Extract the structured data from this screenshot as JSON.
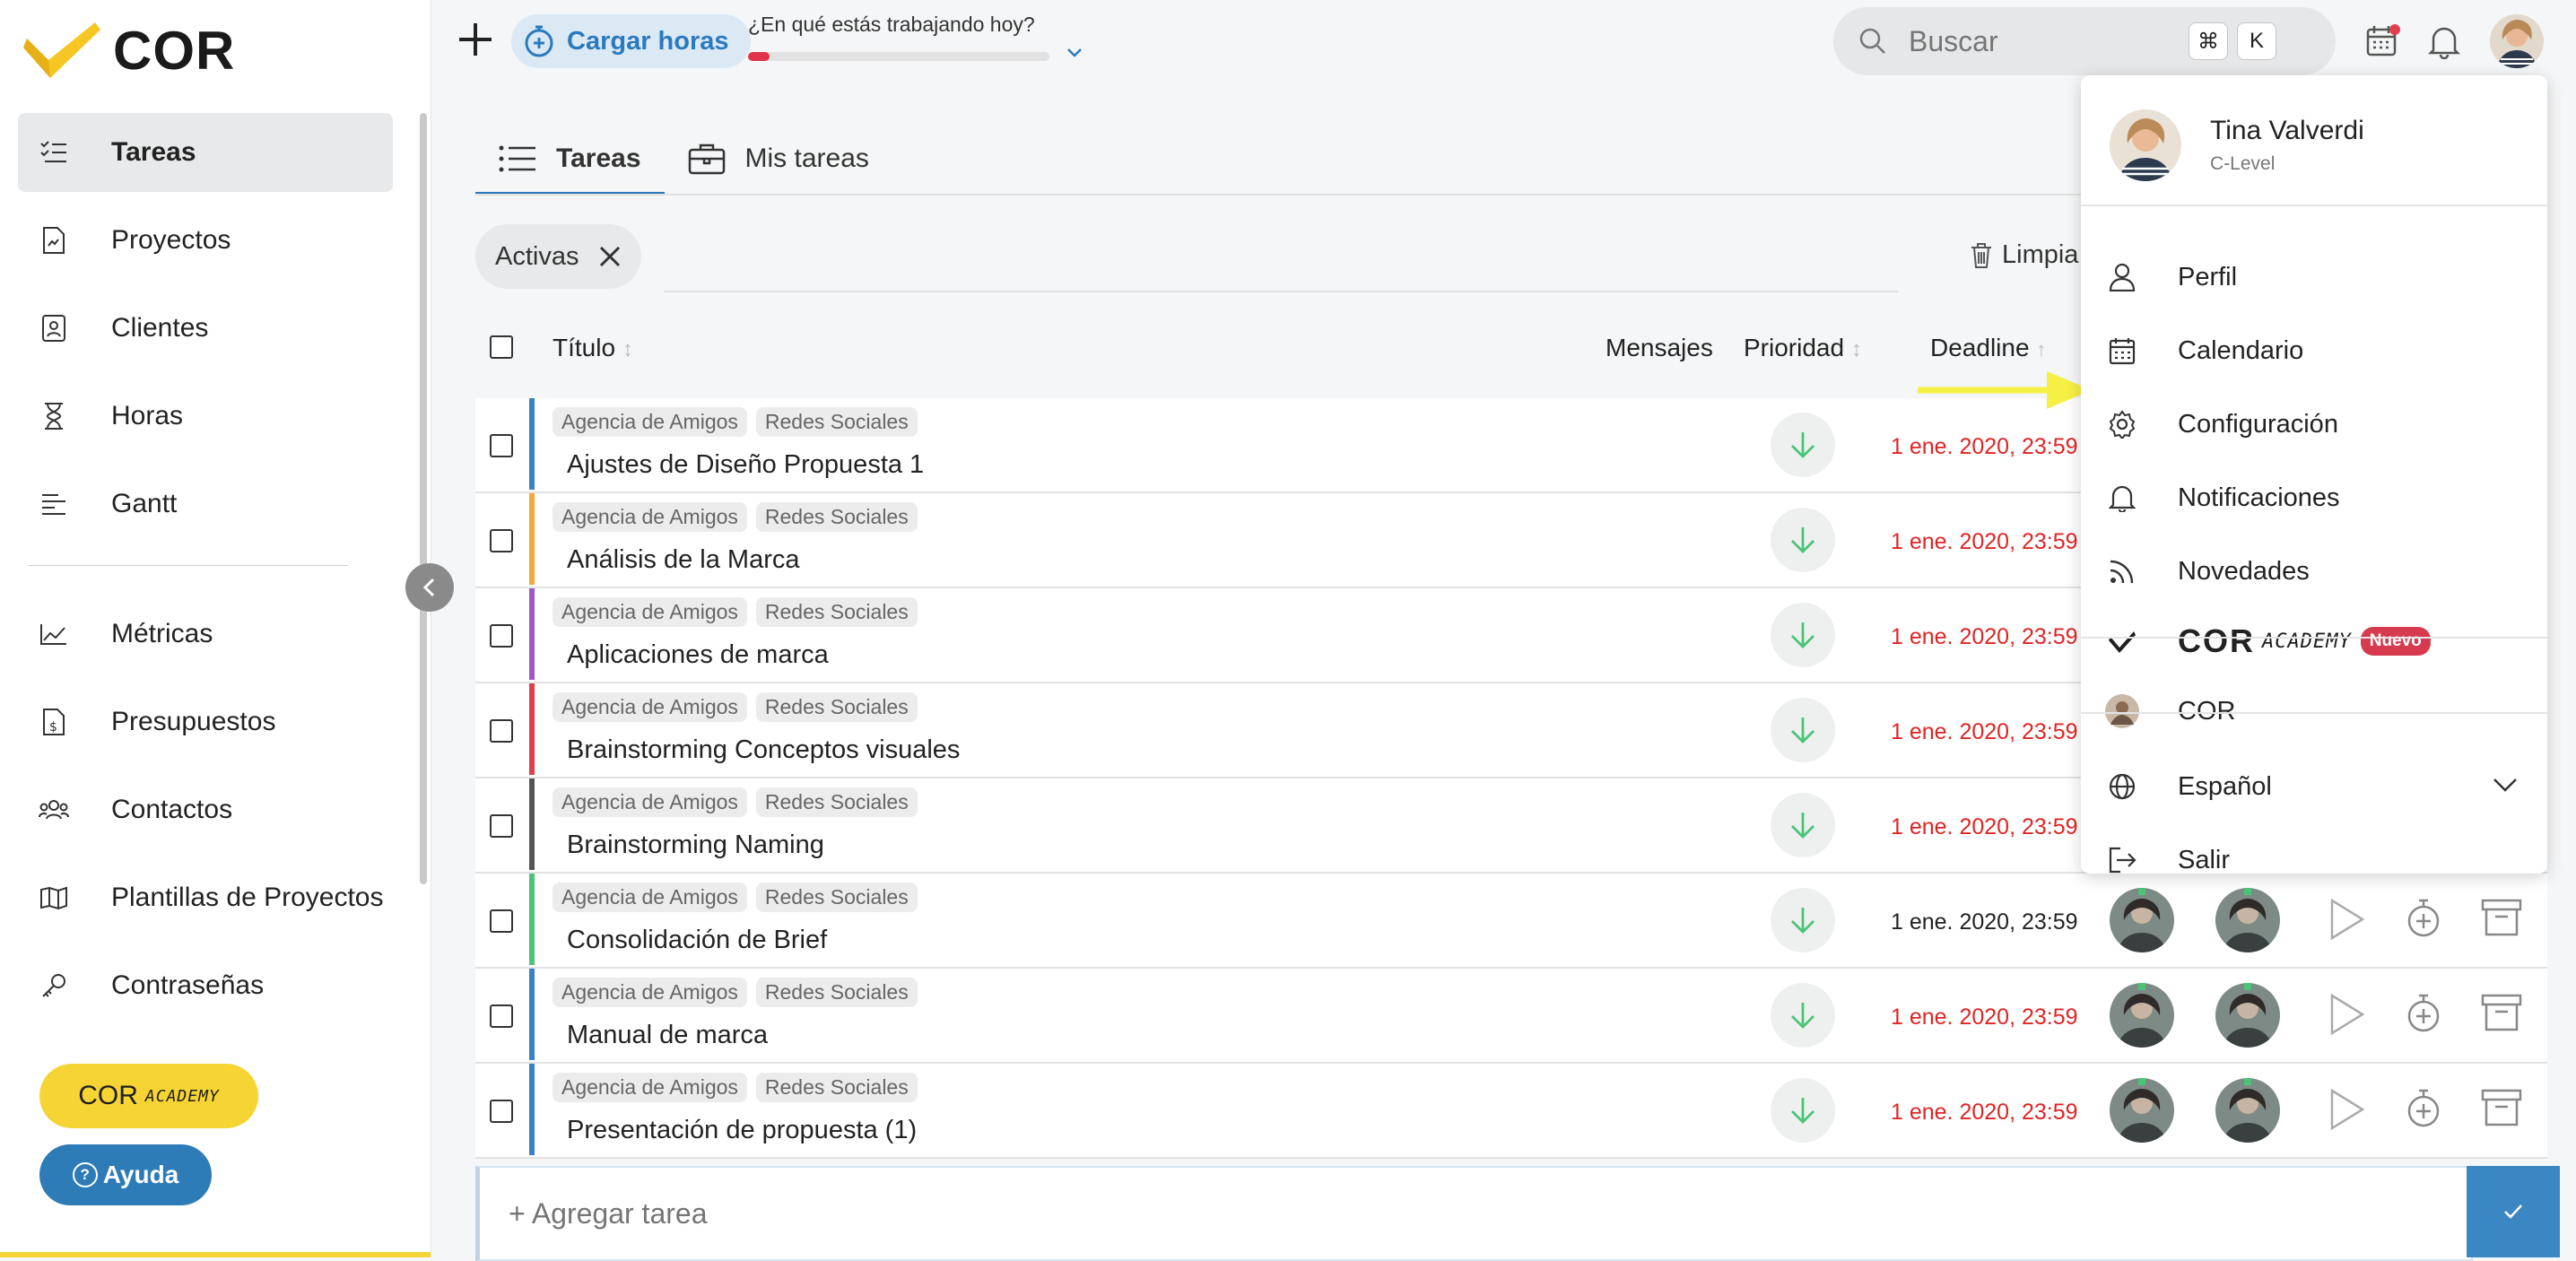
{
  "brand": {
    "logo_text": "COR"
  },
  "sidebar": {
    "items": [
      {
        "label": "Tareas",
        "icon": "tasks-list-icon"
      },
      {
        "label": "Proyectos",
        "icon": "project-file-icon"
      },
      {
        "label": "Clientes",
        "icon": "client-card-icon"
      },
      {
        "label": "Horas",
        "icon": "hourglass-icon"
      },
      {
        "label": "Gantt",
        "icon": "gantt-icon"
      },
      {
        "label": "Métricas",
        "icon": "metrics-chart-icon"
      },
      {
        "label": "Presupuestos",
        "icon": "budget-icon"
      },
      {
        "label": "Contactos",
        "icon": "contacts-icon"
      },
      {
        "label": "Plantillas de Proyectos",
        "icon": "book-icon"
      },
      {
        "label": "Contraseñas",
        "icon": "key-icon"
      }
    ],
    "academy_label": "COR",
    "academy_suffix": "ACADEMY",
    "help_label": "Ayuda"
  },
  "topbar": {
    "cargar_label": "Cargar horas",
    "working_question": "¿En qué estás trabajando hoy?",
    "progress": 0.07,
    "search_placeholder": "Buscar",
    "kbd_cmd": "⌘",
    "kbd_k": "K"
  },
  "tabs": [
    {
      "label": "Tareas"
    },
    {
      "label": "Mis tareas"
    }
  ],
  "filter": {
    "chip_label": "Activas",
    "clear_label": "Limpia"
  },
  "table": {
    "headers": {
      "title": "Título",
      "messages": "Mensajes",
      "priority": "Prioridad",
      "deadline": "Deadline"
    },
    "rows": [
      {
        "client": "Agencia de Amigos",
        "category": "Redes Sociales",
        "title": "Ajustes de Diseño Propuesta 1",
        "deadline": "1 ene. 2020, 23:59",
        "overdue": true,
        "color": "#3b82c4"
      },
      {
        "client": "Agencia de Amigos",
        "category": "Redes Sociales",
        "title": "Análisis de la Marca",
        "deadline": "1 ene. 2020, 23:59",
        "overdue": true,
        "color": "#f2a93b"
      },
      {
        "client": "Agencia de Amigos",
        "category": "Redes Sociales",
        "title": "Aplicaciones de marca",
        "deadline": "1 ene. 2020, 23:59",
        "overdue": true,
        "color": "#9b59c9"
      },
      {
        "client": "Agencia de Amigos",
        "category": "Redes Sociales",
        "title": "Brainstorming Conceptos visuales",
        "deadline": "1 ene. 2020, 23:59",
        "overdue": true,
        "color": "#e0404e"
      },
      {
        "client": "Agencia de Amigos",
        "category": "Redes Sociales",
        "title": "Brainstorming Naming",
        "deadline": "1 ene. 2020, 23:59",
        "overdue": true,
        "color": "#555555"
      },
      {
        "client": "Agencia de Amigos",
        "category": "Redes Sociales",
        "title": "Consolidación de Brief",
        "deadline": "1 ene. 2020, 23:59",
        "overdue": false,
        "color": "#4cc478"
      },
      {
        "client": "Agencia de Amigos",
        "category": "Redes Sociales",
        "title": "Manual de marca",
        "deadline": "1 ene. 2020, 23:59",
        "overdue": true,
        "color": "#3b82c4"
      },
      {
        "client": "Agencia de Amigos",
        "category": "Redes Sociales",
        "title": "Presentación de propuesta (1)",
        "deadline": "1 ene. 2020, 23:59",
        "overdue": true,
        "color": "#3b82c4"
      }
    ]
  },
  "add_task": {
    "placeholder": "+ Agregar tarea"
  },
  "user_menu": {
    "name": "Tina Valverdi",
    "role": "C-Level",
    "items": {
      "perfil": "Perfil",
      "calendario": "Calendario",
      "configuracion": "Configuración",
      "notificaciones": "Notificaciones",
      "novedades": "Novedades",
      "academy_cor": "COR",
      "academy_word": "ACADEMY",
      "nuevo_badge": "Nuevo",
      "company": "COR",
      "language": "Español",
      "salir": "Salir"
    }
  },
  "colors": {
    "accent": "#2b7abd",
    "overdue": "#e02424",
    "priority_low": "#4cc478",
    "academy_yellow": "#f6d433",
    "help_blue": "#2d7cb8"
  }
}
